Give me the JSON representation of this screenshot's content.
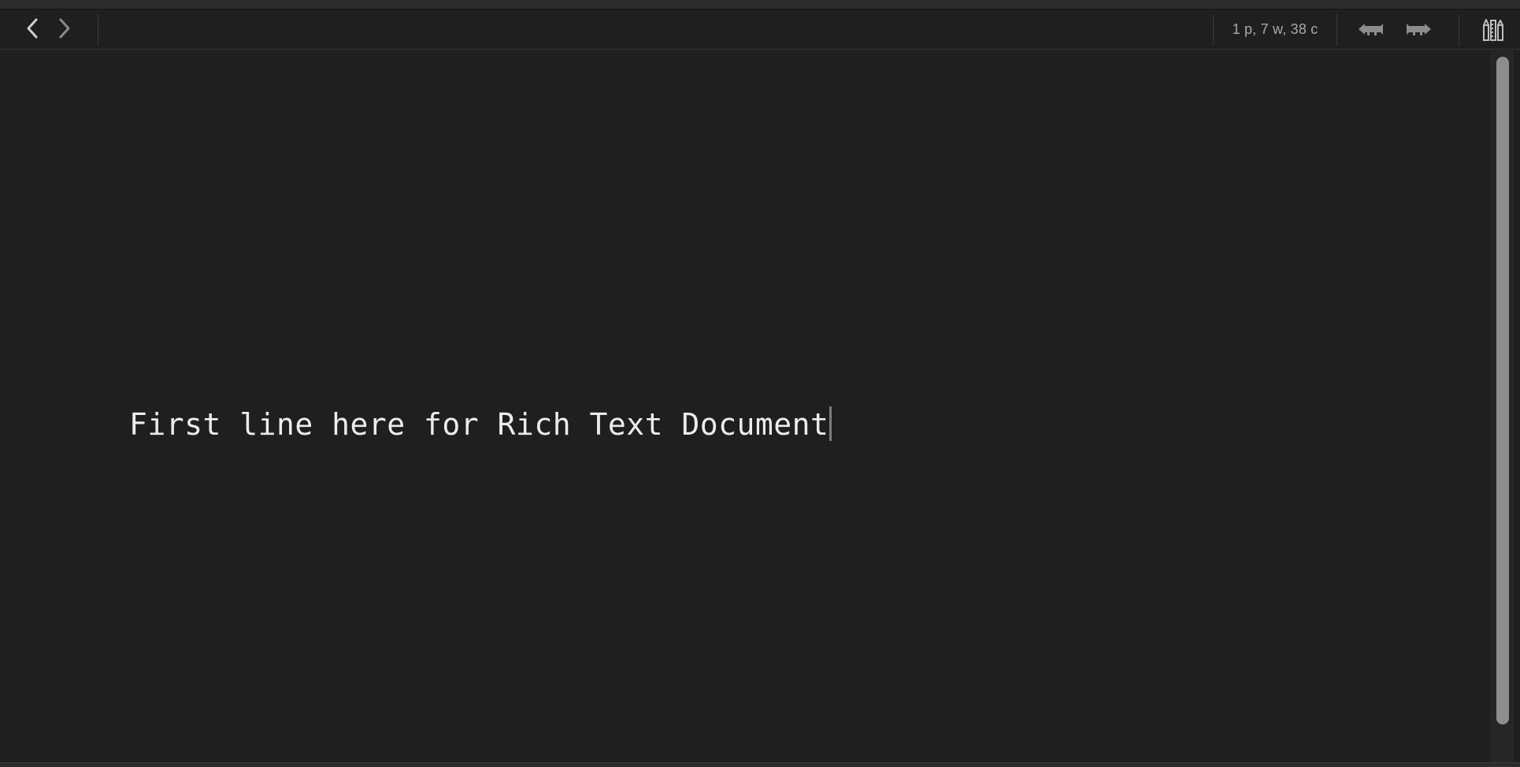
{
  "toolbar": {
    "nav_back_icon": "chevron-left-icon",
    "nav_forward_icon": "chevron-right-icon",
    "counts": "1 p, 7 w, 38 c",
    "jump_prev_icon": "arrow-left-icon",
    "jump_next_icon": "arrow-right-icon",
    "tools_icon": "pencil-ruler-icon"
  },
  "document": {
    "first_line": "First line here for Rich Text Document"
  },
  "colors": {
    "background": "#1f1f1f",
    "text": "#ececec",
    "muted_text": "#a9a9a9",
    "scroll_thumb": "#8d8d8d"
  }
}
